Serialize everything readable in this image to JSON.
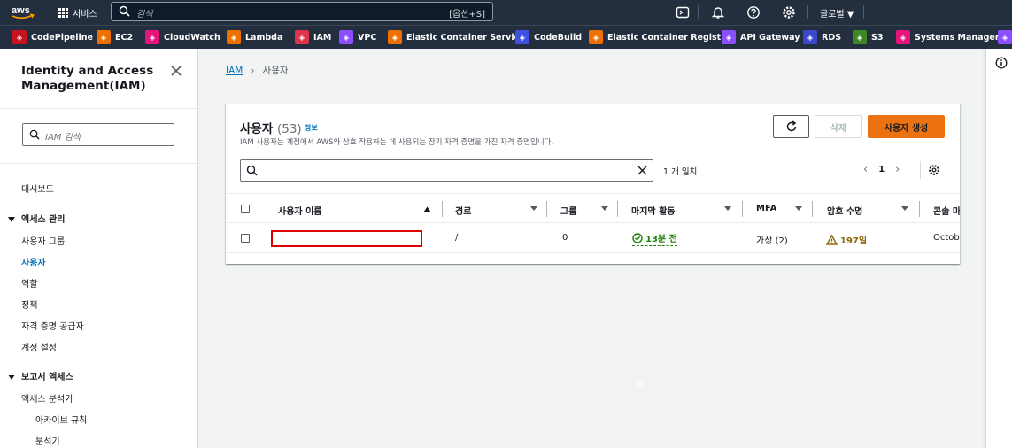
{
  "topnav": {
    "logo_text": "aws",
    "services_label": "서비스",
    "search_placeholder": "검색",
    "search_shortcut": "[옵션+S]",
    "region_label": "글로벌",
    "colors": {
      "bg": "#232f3e",
      "accent": "#ff9900"
    }
  },
  "favorites": [
    {
      "label": "CodePipeline",
      "icon": "codepipeline-icon",
      "color": "#c7131f"
    },
    {
      "label": "EC2",
      "icon": "ec2-icon",
      "color": "#ed7100"
    },
    {
      "label": "CloudWatch",
      "icon": "cloudwatch-icon",
      "color": "#e7157b"
    },
    {
      "label": "Lambda",
      "icon": "lambda-icon",
      "color": "#ed7100"
    },
    {
      "label": "IAM",
      "icon": "iam-icon",
      "color": "#dd344c"
    },
    {
      "label": "VPC",
      "icon": "vpc-icon",
      "color": "#8c4fff"
    },
    {
      "label": "Elastic Container Service",
      "icon": "ecs-icon",
      "color": "#ed7100"
    },
    {
      "label": "CodeBuild",
      "icon": "codebuild-icon",
      "color": "#3f51e0"
    },
    {
      "label": "Elastic Container Registry",
      "icon": "ecr-icon",
      "color": "#ed7100"
    },
    {
      "label": "API Gateway",
      "icon": "api-gateway-icon",
      "color": "#8c4fff"
    },
    {
      "label": "RDS",
      "icon": "rds-icon",
      "color": "#3b48cc"
    },
    {
      "label": "S3",
      "icon": "s3-icon",
      "color": "#3f8624"
    },
    {
      "label": "Systems Manager",
      "icon": "systems-manager-icon",
      "color": "#e7157b"
    }
  ],
  "sidebar": {
    "title": "Identity and Access Management(IAM)",
    "search_placeholder": "IAM 검색",
    "dashboard": "대시보드",
    "access_section": "액세스 관리",
    "access_items": [
      "사용자 그룹",
      "사용자",
      "역할",
      "정책",
      "자격 증명 공급자",
      "계정 설정"
    ],
    "active_item": "사용자",
    "reports_section": "보고서 액세스",
    "reports_items": [
      "액세스 분석기",
      "아카이브 규칙",
      "분석기"
    ]
  },
  "breadcrumb": {
    "root": "IAM",
    "current": "사용자"
  },
  "panel": {
    "title": "사용자",
    "count": "(53)",
    "info_link": "정보",
    "description": "IAM 사용자는 계정에서 AWS와 상호 작용하는 데 사용되는 장기 자격 증명을 가진 자격 증명입니다.",
    "delete_label": "삭제",
    "create_label": "사용자 생성",
    "match_text": "1 개 일치",
    "page_number": "1"
  },
  "table": {
    "columns": [
      "사용자 이름",
      "경로",
      "그룹",
      "마지막 활동",
      "MFA",
      "암호 수명",
      "콘솔 마"
    ],
    "rows": [
      {
        "username": "",
        "path": "/",
        "groups": "0",
        "last_activity": "13분 전",
        "mfa": "가상 (2)",
        "password_age": "197일",
        "console": "Octob"
      }
    ]
  }
}
